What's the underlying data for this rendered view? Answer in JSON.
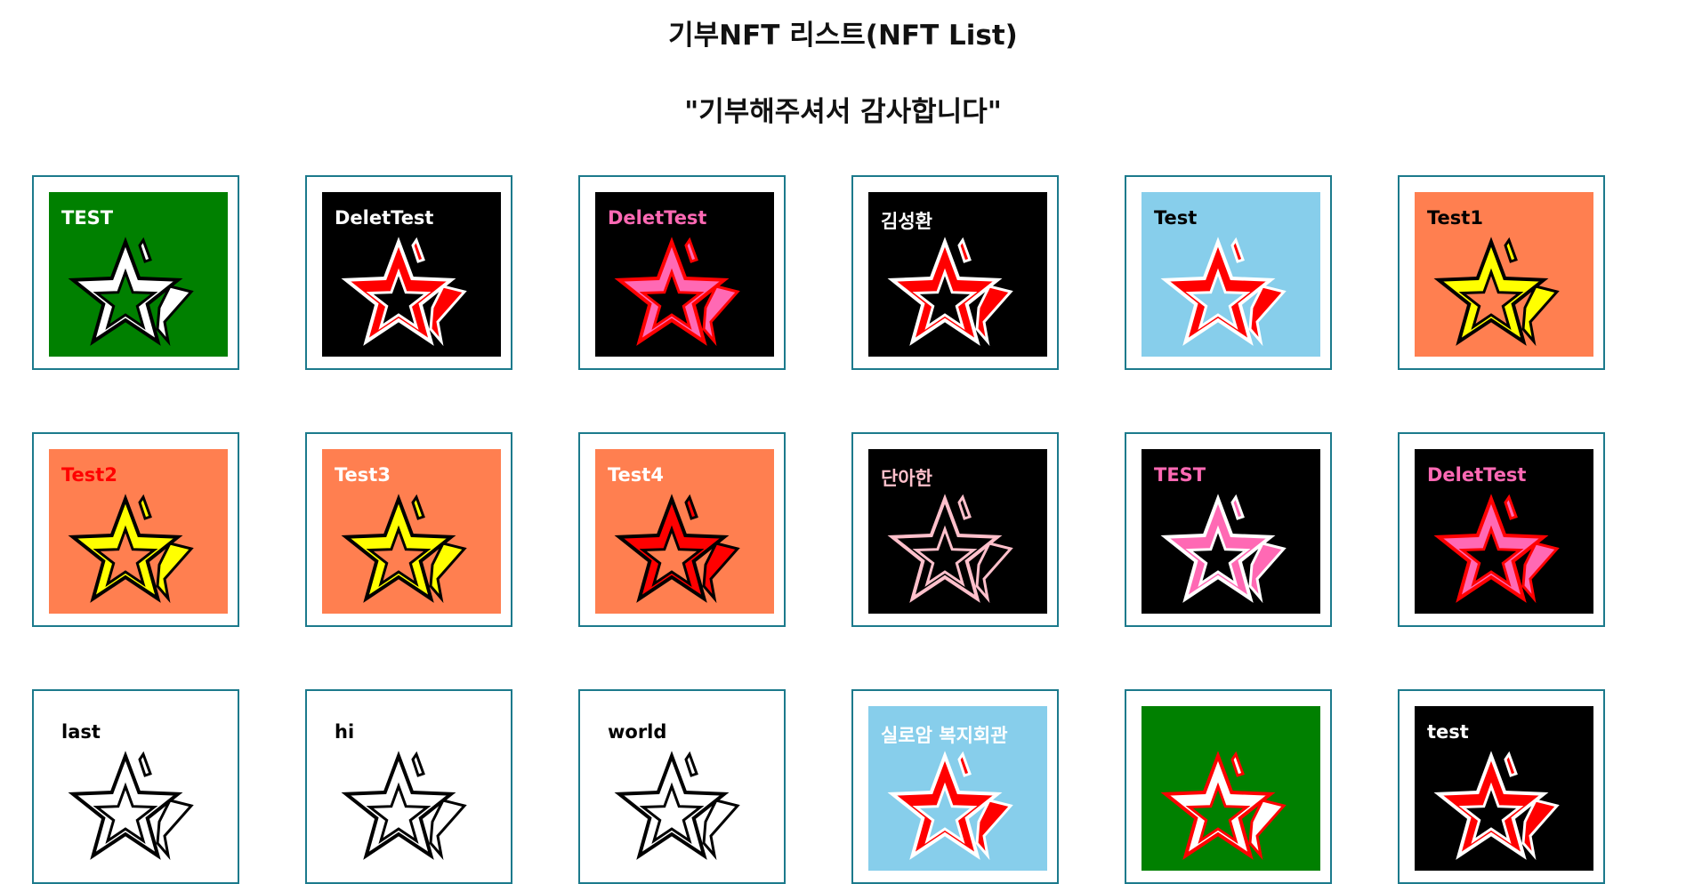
{
  "page": {
    "title": "기부NFT 리스트(NFT List)",
    "subtitle": "\"기부해주셔서 감사합니다\""
  },
  "nfts": [
    {
      "name": "TEST",
      "bg": "#008000",
      "text_color": "#ffffff",
      "star_fill": "#ffffff",
      "star_stroke": "#000000",
      "icon": "star-icon"
    },
    {
      "name": "DeletTest",
      "bg": "#000000",
      "text_color": "#ffffff",
      "star_fill": "#ff0000",
      "star_stroke": "#ffffff",
      "icon": "star-icon"
    },
    {
      "name": "DeletTest",
      "bg": "#000000",
      "text_color": "#ff69b4",
      "star_fill": "#ff69b4",
      "star_stroke": "#ff0000",
      "icon": "star-icon"
    },
    {
      "name": "김성환",
      "bg": "#000000",
      "text_color": "#ffffff",
      "star_fill": "#ff0000",
      "star_stroke": "#ffffff",
      "icon": "star-icon"
    },
    {
      "name": "Test",
      "bg": "#87ceeb",
      "text_color": "#000000",
      "star_fill": "#ff0000",
      "star_stroke": "#ffffff",
      "icon": "star-icon"
    },
    {
      "name": "Test1",
      "bg": "#ff7f50",
      "text_color": "#000000",
      "star_fill": "#ffff00",
      "star_stroke": "#000000",
      "icon": "star-icon"
    },
    {
      "name": "Test2",
      "bg": "#ff7f50",
      "text_color": "#ff0000",
      "star_fill": "#ffff00",
      "star_stroke": "#000000",
      "icon": "star-icon"
    },
    {
      "name": "Test3",
      "bg": "#ff7f50",
      "text_color": "#ffffff",
      "star_fill": "#ffff00",
      "star_stroke": "#000000",
      "icon": "star-icon"
    },
    {
      "name": "Test4",
      "bg": "#ff7f50",
      "text_color": "#ffffff",
      "star_fill": "#ff0000",
      "star_stroke": "#000000",
      "icon": "star-icon"
    },
    {
      "name": "단아한",
      "bg": "#000000",
      "text_color": "#ffc0cb",
      "star_fill": "#000000",
      "star_stroke": "#ffc0cb",
      "icon": "star-icon"
    },
    {
      "name": "TEST",
      "bg": "#000000",
      "text_color": "#ff69b4",
      "star_fill": "#ff69b4",
      "star_stroke": "#ffffff",
      "icon": "star-icon"
    },
    {
      "name": "DeletTest",
      "bg": "#000000",
      "text_color": "#ff69b4",
      "star_fill": "#ff69b4",
      "star_stroke": "#ff0000",
      "icon": "star-icon"
    },
    {
      "name": "last",
      "bg": "#ffffff",
      "text_color": "#000000",
      "star_fill": "#ffffff",
      "star_stroke": "#000000",
      "icon": "star-icon"
    },
    {
      "name": "hi",
      "bg": "#ffffff",
      "text_color": "#000000",
      "star_fill": "#ffffff",
      "star_stroke": "#000000",
      "icon": "star-icon"
    },
    {
      "name": "world",
      "bg": "#ffffff",
      "text_color": "#000000",
      "star_fill": "#ffffff",
      "star_stroke": "#000000",
      "icon": "star-icon"
    },
    {
      "name": "실로암 복지회관",
      "bg": "#87ceeb",
      "text_color": "#ffffff",
      "star_fill": "#ff0000",
      "star_stroke": "#ffffff",
      "icon": "star-icon"
    },
    {
      "name": "",
      "bg": "#008000",
      "text_color": "#ffffff",
      "star_fill": "#ffffff",
      "star_stroke": "#ff0000",
      "icon": "star-icon"
    },
    {
      "name": "test",
      "bg": "#000000",
      "text_color": "#ffffff",
      "star_fill": "#ff0000",
      "star_stroke": "#ffffff",
      "icon": "star-icon"
    }
  ]
}
